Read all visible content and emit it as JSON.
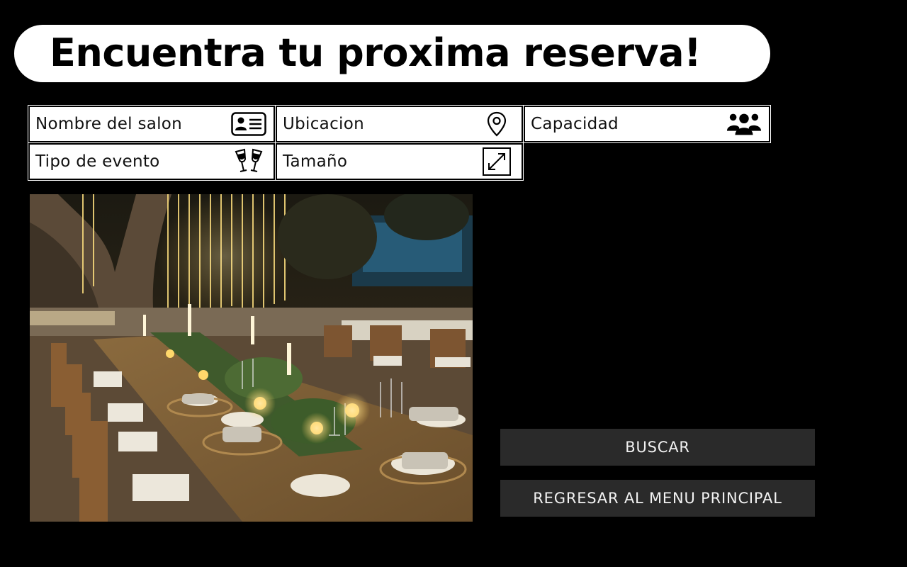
{
  "header": {
    "title": "Encuentra tu proxima reserva!"
  },
  "filters": {
    "nombre": {
      "label": "Nombre del salon",
      "icon": "id-card-icon"
    },
    "ubicacion": {
      "label": "Ubicacion",
      "icon": "map-pin-icon"
    },
    "capacidad": {
      "label": "Capacidad",
      "icon": "people-group-icon"
    },
    "tipo": {
      "label": "Tipo de evento",
      "icon": "champagne-toast-icon"
    },
    "tamano": {
      "label": "Tamaño",
      "icon": "resize-arrows-icon"
    }
  },
  "photo": {
    "subject": "outdoor-banquet-table-with-string-lights"
  },
  "actions": {
    "search_label": "BUSCAR",
    "back_label": "REGRESAR AL MENU PRINCIPAL"
  },
  "colors": {
    "background": "#000000",
    "panel": "#ffffff",
    "button": "#2a2a2a",
    "button_text": "#f2f2f2"
  }
}
